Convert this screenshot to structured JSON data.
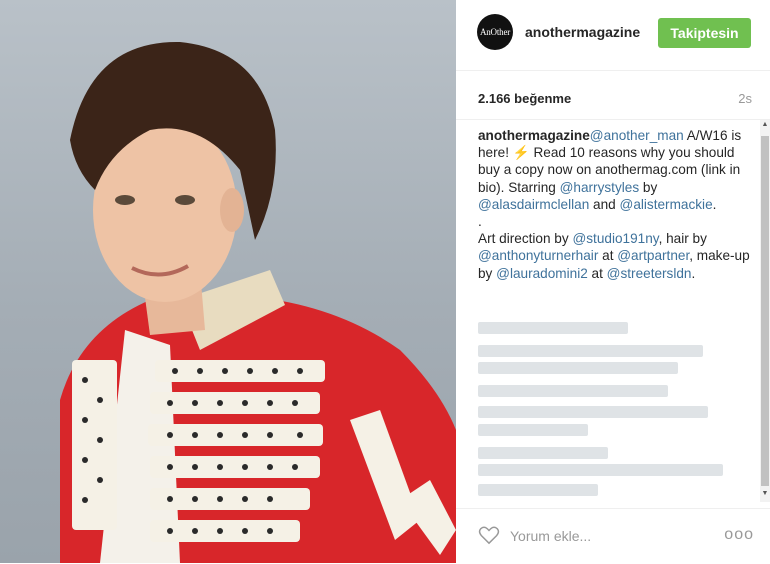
{
  "post": {
    "username": "anothermagazine",
    "avatar_text": "AnOther",
    "follow_label": "Takiptesin",
    "likes": "2.166 beğenme",
    "time_ago": "2s"
  },
  "caption": {
    "author": "anothermagazine",
    "mention_1": "@another_man",
    "text_1": " A/W16 is here! ⚡ Read 10 reasons why you should buy a copy now on anothermag.com (link in bio). Starring ",
    "mention_2": "@harrystyles",
    "text_2": " by ",
    "mention_3": "@alasdairmclellan",
    "text_3": " and ",
    "mention_4": "@alistermackie",
    "text_4": ".",
    "dot": ".",
    "text_5": "Art direction by ",
    "mention_5": "@studio191ny",
    "text_6": ", hair by ",
    "mention_6": "@anthonyturnerhair",
    "text_7": " at ",
    "mention_7": "@artpartner",
    "text_8": ", make-up by ",
    "mention_8": "@lauradomini2",
    "text_9": " at ",
    "mention_9": "@streetersldn",
    "text_10": "."
  },
  "footer": {
    "comment_placeholder": "Yorum ekle...",
    "more_label": "ooo"
  },
  "colors": {
    "follow_button": "#70c050",
    "mention": "#3f729b",
    "jacket": "#d8262a"
  }
}
